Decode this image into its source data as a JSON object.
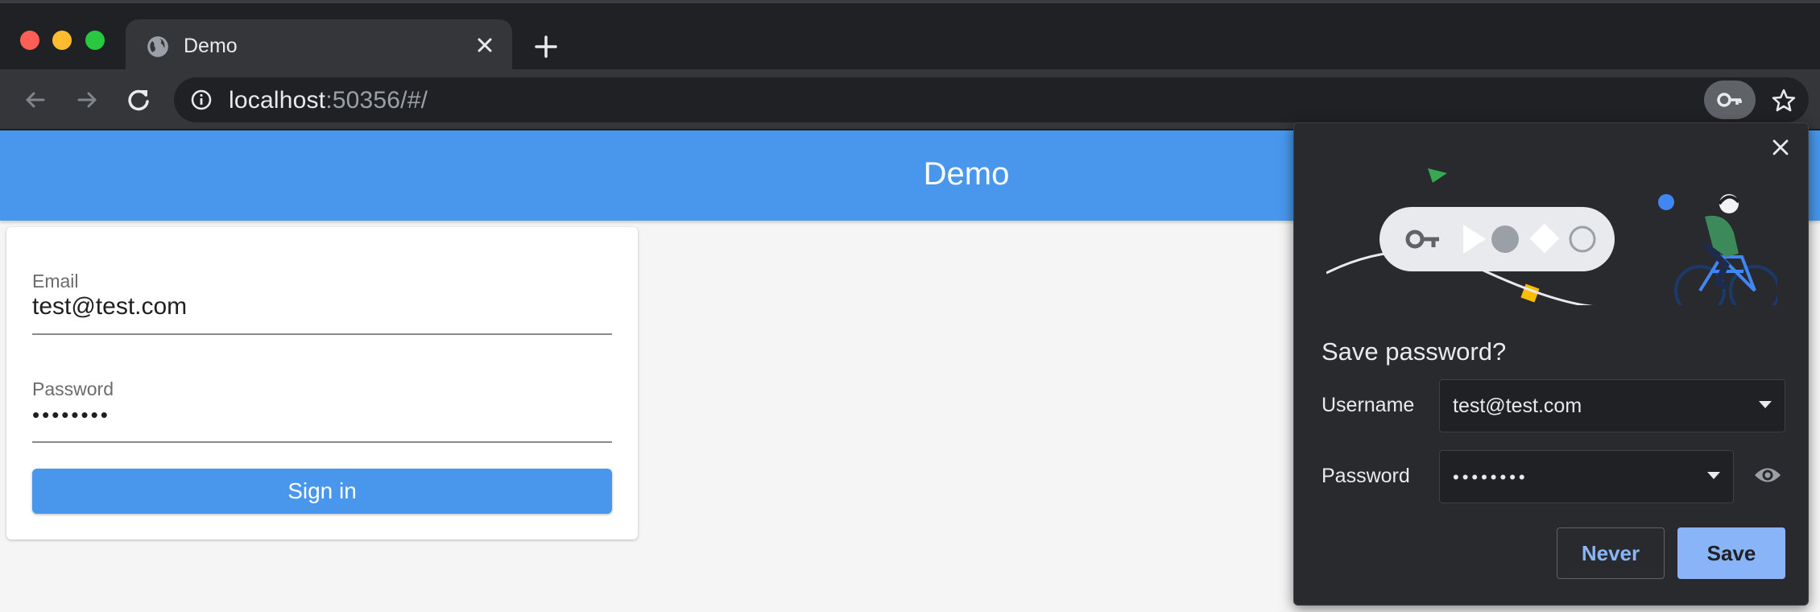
{
  "browser": {
    "tab": {
      "title": "Demo"
    },
    "address": {
      "host": "localhost",
      "rest": ":50356/#/"
    }
  },
  "app": {
    "title": "Demo",
    "form": {
      "email_label": "Email",
      "email_value": "test@test.com",
      "password_label": "Password",
      "password_value": "••••••••",
      "signin_label": "Sign in"
    }
  },
  "password_bubble": {
    "title": "Save password?",
    "username_label": "Username",
    "username_value": "test@test.com",
    "password_label": "Password",
    "password_value": "••••••••",
    "never_label": "Never",
    "save_label": "Save"
  },
  "colors": {
    "appbar": "#4897ec",
    "accent_button": "#8ab4f8",
    "chrome_dark": "#202124"
  },
  "icons": [
    "globe-icon",
    "close-icon",
    "plus-icon",
    "back-arrow-icon",
    "forward-arrow-icon",
    "reload-icon",
    "info-icon",
    "key-icon",
    "star-icon",
    "chevron-down-icon",
    "eye-icon"
  ]
}
